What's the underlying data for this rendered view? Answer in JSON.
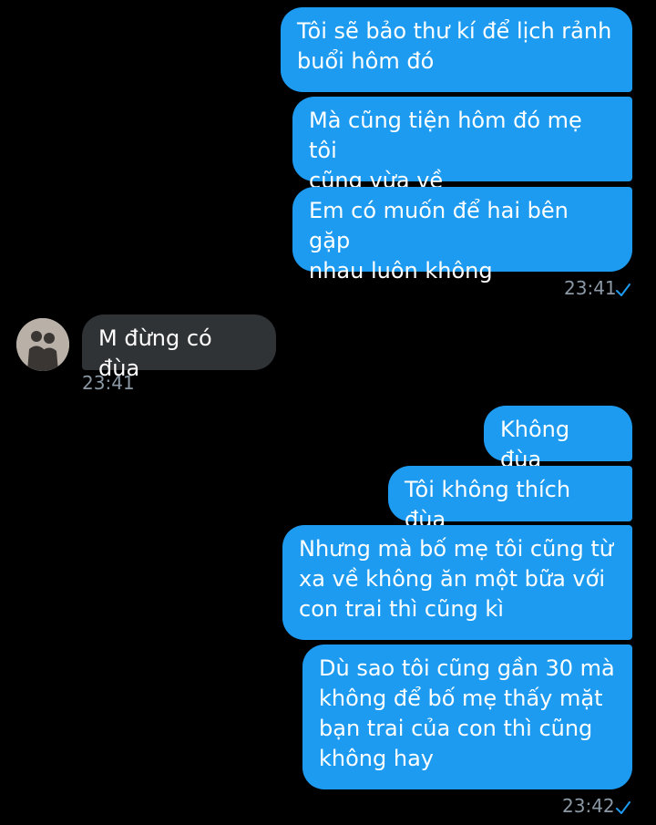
{
  "colors": {
    "background": "#000000",
    "outgoing_bubble": "#1d9bf0",
    "incoming_bubble": "#2f3336",
    "timestamp": "#8b98a5",
    "check": "#1d9bf0"
  },
  "messages": [
    {
      "from": "me",
      "text": "Tôi sẽ bảo thư kí để lịch rảnh\nbuổi hôm đó"
    },
    {
      "from": "me",
      "text": "Mà cũng tiện hôm đó mẹ tôi\ncũng vừa về"
    },
    {
      "from": "me",
      "text": "Em có muốn để hai bên gặp\nnhau luôn không"
    },
    {
      "from": "them",
      "text": "M đừng có đùa"
    },
    {
      "from": "me",
      "text": "Không đùa"
    },
    {
      "from": "me",
      "text": "Tôi không thích đùa"
    },
    {
      "from": "me",
      "text": "Nhưng mà bố mẹ tôi cũng từ\nxa về không ăn một bữa với\ncon trai thì cũng kì"
    },
    {
      "from": "me",
      "text": "Dù sao tôi cũng gần 30 mà\nkhông để bố mẹ thấy mặt\nbạn trai của con thì cũng\nkhông hay"
    }
  ],
  "timestamps": {
    "group1": "23:41",
    "incoming": "23:41",
    "group2": "23:42"
  },
  "icons": {
    "read_receipt": "check-icon",
    "contact_avatar": "avatar"
  }
}
